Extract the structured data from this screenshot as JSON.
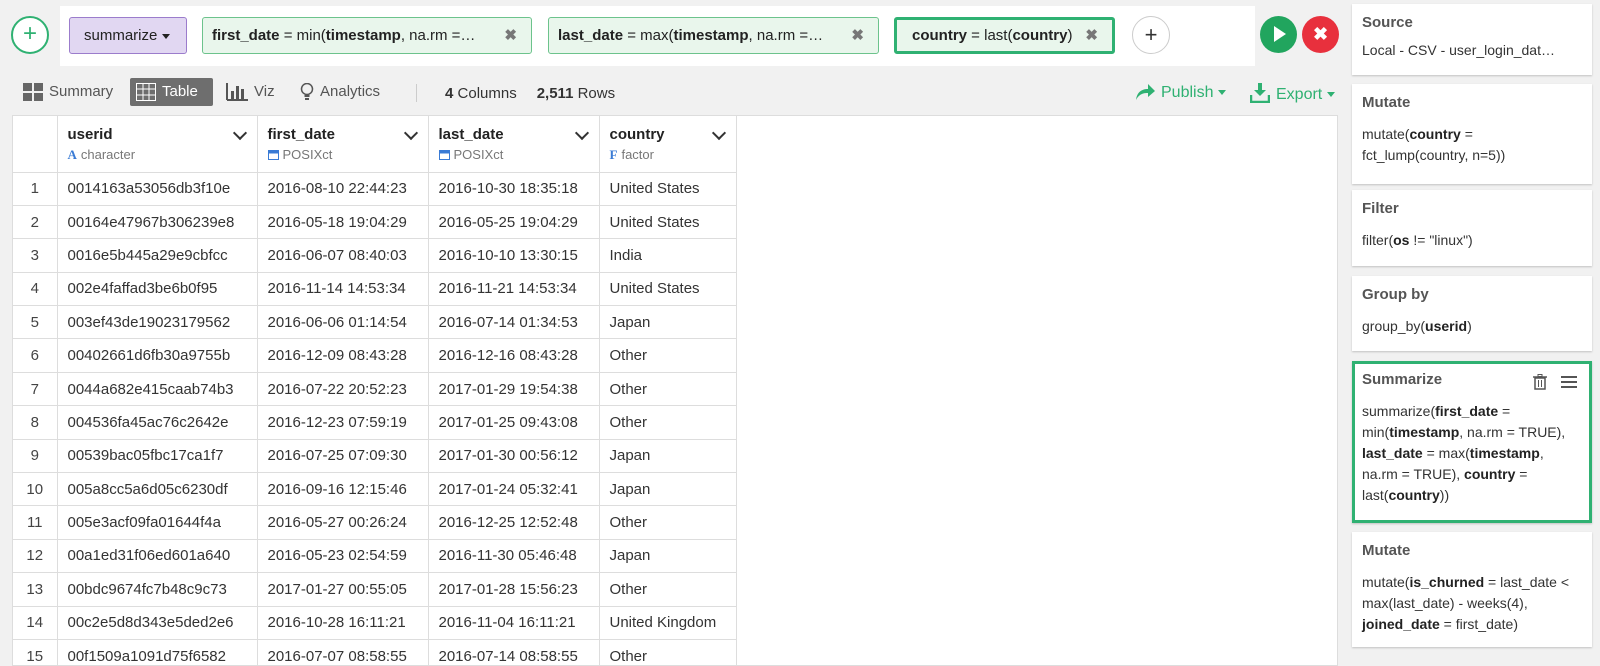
{
  "command": {
    "name": "summarize",
    "tokens": [
      {
        "name": "first_date",
        "eq": " = min(",
        "arg": "timestamp",
        "rest": ", na.rm =…"
      },
      {
        "name": "last_date",
        "eq": " = max(",
        "arg": "timestamp",
        "rest": ", na.rm =…"
      },
      {
        "name": "country",
        "eq": " = last(",
        "arg": "country",
        "rest": ")"
      }
    ],
    "remove_glyph": "✖",
    "add_glyph": "+",
    "cancel_glyph": "✖"
  },
  "view": {
    "tabs": {
      "summary": "Summary",
      "table": "Table",
      "viz": "Viz",
      "analytics": "Analytics"
    },
    "columns_count": "4",
    "columns_label": "Columns",
    "rows_count": "2,511",
    "rows_label": "Rows",
    "publish": "Publish",
    "export": "Export"
  },
  "table": {
    "columns": [
      {
        "name": "userid",
        "type": "character",
        "type_icon": "A"
      },
      {
        "name": "first_date",
        "type": "POSIXct",
        "type_icon": "calendar-icon"
      },
      {
        "name": "last_date",
        "type": "POSIXct",
        "type_icon": "calendar-icon"
      },
      {
        "name": "country",
        "type": "factor",
        "type_icon": "F"
      }
    ],
    "rows": [
      [
        "1",
        "0014163a53056db3f10e",
        "2016-08-10 22:44:23",
        "2016-10-30 18:35:18",
        "United States"
      ],
      [
        "2",
        "00164e47967b306239e8",
        "2016-05-18 19:04:29",
        "2016-05-25 19:04:29",
        "United States"
      ],
      [
        "3",
        "0016e5b445a29e9cbfcc",
        "2016-06-07 08:40:03",
        "2016-10-10 13:30:15",
        "India"
      ],
      [
        "4",
        "002e4faffad3be6b0f95",
        "2016-11-14 14:53:34",
        "2016-11-21 14:53:34",
        "United States"
      ],
      [
        "5",
        "003ef43de19023179562",
        "2016-06-06 01:14:54",
        "2016-07-14 01:34:53",
        "Japan"
      ],
      [
        "6",
        "00402661d6fb30a9755b",
        "2016-12-09 08:43:28",
        "2016-12-16 08:43:28",
        "Other"
      ],
      [
        "7",
        "0044a682e415caab74b3",
        "2016-07-22 20:52:23",
        "2017-01-29 19:54:38",
        "Other"
      ],
      [
        "8",
        "004536fa45ac76c2642e",
        "2016-12-23 07:59:19",
        "2017-01-25 09:43:08",
        "Other"
      ],
      [
        "9",
        "00539bac05fbc17ca1f7",
        "2016-07-25 07:09:30",
        "2017-01-30 00:56:12",
        "Japan"
      ],
      [
        "10",
        "005a8cc5a6d05c6230df",
        "2016-09-16 12:15:46",
        "2017-01-24 05:32:41",
        "Japan"
      ],
      [
        "11",
        "005e3acf09fa01644f4a",
        "2016-05-27 00:26:24",
        "2016-12-25 12:52:48",
        "Other"
      ],
      [
        "12",
        "00a1ed31f06ed601a640",
        "2016-05-23 02:54:59",
        "2016-11-30 05:46:48",
        "Japan"
      ],
      [
        "13",
        "00bdc9674fc7b48c9c73",
        "2017-01-27 00:55:05",
        "2017-01-28 15:56:23",
        "Other"
      ],
      [
        "14",
        "00c2e5d8d343e5ded2e6",
        "2016-10-28 16:11:21",
        "2016-11-04 16:11:21",
        "United Kingdom"
      ],
      [
        "15",
        "00f1509a1091d75f6582",
        "2016-07-07 08:58:55",
        "2016-07-14 08:58:55",
        "Other"
      ]
    ]
  },
  "steps": {
    "source": {
      "title": "Source",
      "body": "Local - CSV - user_login_dat…"
    },
    "mutate1": {
      "title": "Mutate",
      "body_pre": "mutate(",
      "body_bold": "country",
      "body_post": " = fct_lump(country, n=5))"
    },
    "filter": {
      "title": "Filter",
      "body_pre": "filter(",
      "body_bold": "os",
      "body_post": " != \"linux\")"
    },
    "group_by": {
      "title": "Group by",
      "body_pre": "group_by(",
      "body_bold": "userid",
      "body_post": ")"
    },
    "summarize": {
      "title": "Summarize",
      "parts": [
        "summarize(",
        "first_date",
        " = min(",
        "timestamp",
        ", na.rm = TRUE), ",
        "last_date",
        " = max(",
        "timestamp",
        ", na.rm = TRUE), ",
        "country",
        " = last(",
        "country",
        "))"
      ]
    },
    "mutate2": {
      "title": "Mutate",
      "parts": [
        "mutate(",
        "is_churned",
        " = last_date < max(last_date) - weeks(4), ",
        "joined_date",
        " = first_date)"
      ]
    }
  },
  "colors": {
    "accent": "#2fb172",
    "run": "#21a55e",
    "cancel": "#e8303d",
    "command": "#e1d7f2"
  }
}
